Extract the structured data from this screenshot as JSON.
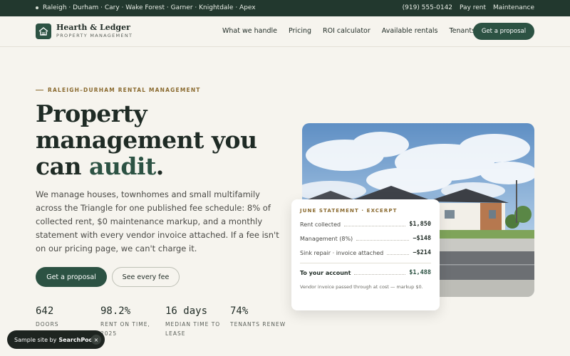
{
  "topbar": {
    "service_areas": "Raleigh · Durham · Cary · Wake Forest · Garner · Knightdale · Apex",
    "phone": "(919) 555‑0142",
    "pay_rent": "Pay rent",
    "maintenance": "Maintenance"
  },
  "header": {
    "brand_name": "Hearth & Ledger",
    "brand_sub": "PROPERTY MANAGEMENT",
    "nav": [
      "What we handle",
      "Pricing",
      "ROI calculator",
      "Available rentals",
      "Tenants"
    ],
    "cta": "Get a proposal",
    "logo_icon": "house-icon"
  },
  "hero": {
    "eyebrow": "RALEIGH–DURHAM RENTAL MANAGEMENT",
    "headline_main": "Property management you can",
    "headline_accent": "audit",
    "headline_end": ".",
    "lead": "We manage houses, townhomes and small multifamily across the Triangle for one published fee schedule: 8% of collected rent, $0 maintenance markup, and a monthly statement with every vendor invoice attached. If a fee isn't on our pricing page, we can't charge it.",
    "primary_cta": "Get a proposal",
    "secondary_cta": "See every fee"
  },
  "stats": [
    {
      "num": "642",
      "label": "DOORS"
    },
    {
      "num": "98.2%",
      "label": "RENT ON TIME, 2025"
    },
    {
      "num": "16 days",
      "label": "MEDIAN TIME TO LEASE"
    },
    {
      "num": "74%",
      "label": "TENANTS RENEW"
    }
  ],
  "statement": {
    "title": "JUNE STATEMENT · EXCERPT",
    "rows": [
      {
        "label": "Rent collected",
        "value": "$1,850"
      },
      {
        "label": "Management (8%)",
        "value": "−$148"
      },
      {
        "label": "Sink repair · invoice attached",
        "value": "−$214"
      }
    ],
    "total_label": "To your account",
    "total_value": "$1,488",
    "note": "Vendor invoice passed through at cost — markup $0."
  },
  "toast": {
    "prefix": "Sample site by",
    "brand": "SearchPod",
    "close": "×"
  },
  "colors": {
    "brand_green": "#2c5243",
    "topbar": "#22382e",
    "accent_gold": "#8a6a2f",
    "background": "#f6f4ee"
  }
}
